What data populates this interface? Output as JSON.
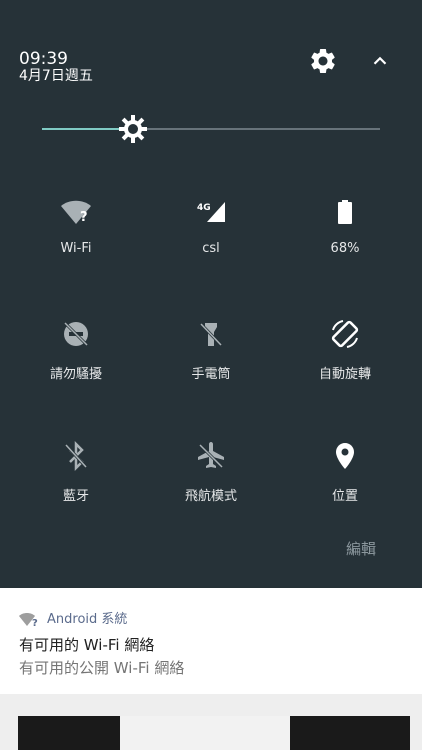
{
  "status": {
    "time": "09:39",
    "date": "4月7日週五"
  },
  "brightness": {
    "level": 0.27
  },
  "tiles": [
    {
      "label": "Wi-Fi",
      "icon": "wifi-unknown-icon"
    },
    {
      "label": "csl",
      "icon": "cellular-signal-icon",
      "badge": "4G"
    },
    {
      "label": "68%",
      "icon": "battery-icon"
    },
    {
      "label": "請勿騷擾",
      "icon": "do-not-disturb-icon"
    },
    {
      "label": "手電筒",
      "icon": "flashlight-off-icon"
    },
    {
      "label": "自動旋轉",
      "icon": "auto-rotate-icon"
    },
    {
      "label": "藍牙",
      "icon": "bluetooth-off-icon"
    },
    {
      "label": "飛航模式",
      "icon": "airplane-mode-icon"
    },
    {
      "label": "位置",
      "icon": "location-icon"
    }
  ],
  "edit_label": "編輯",
  "notification": {
    "app": "Android 系統",
    "title": "有可用的 Wi-Fi 網絡",
    "text": "有可用的公開 Wi-Fi 網絡"
  },
  "colors": {
    "shade_bg": "#263238",
    "accent": "#80cbc4",
    "notif_app": "#5c6bc0"
  }
}
